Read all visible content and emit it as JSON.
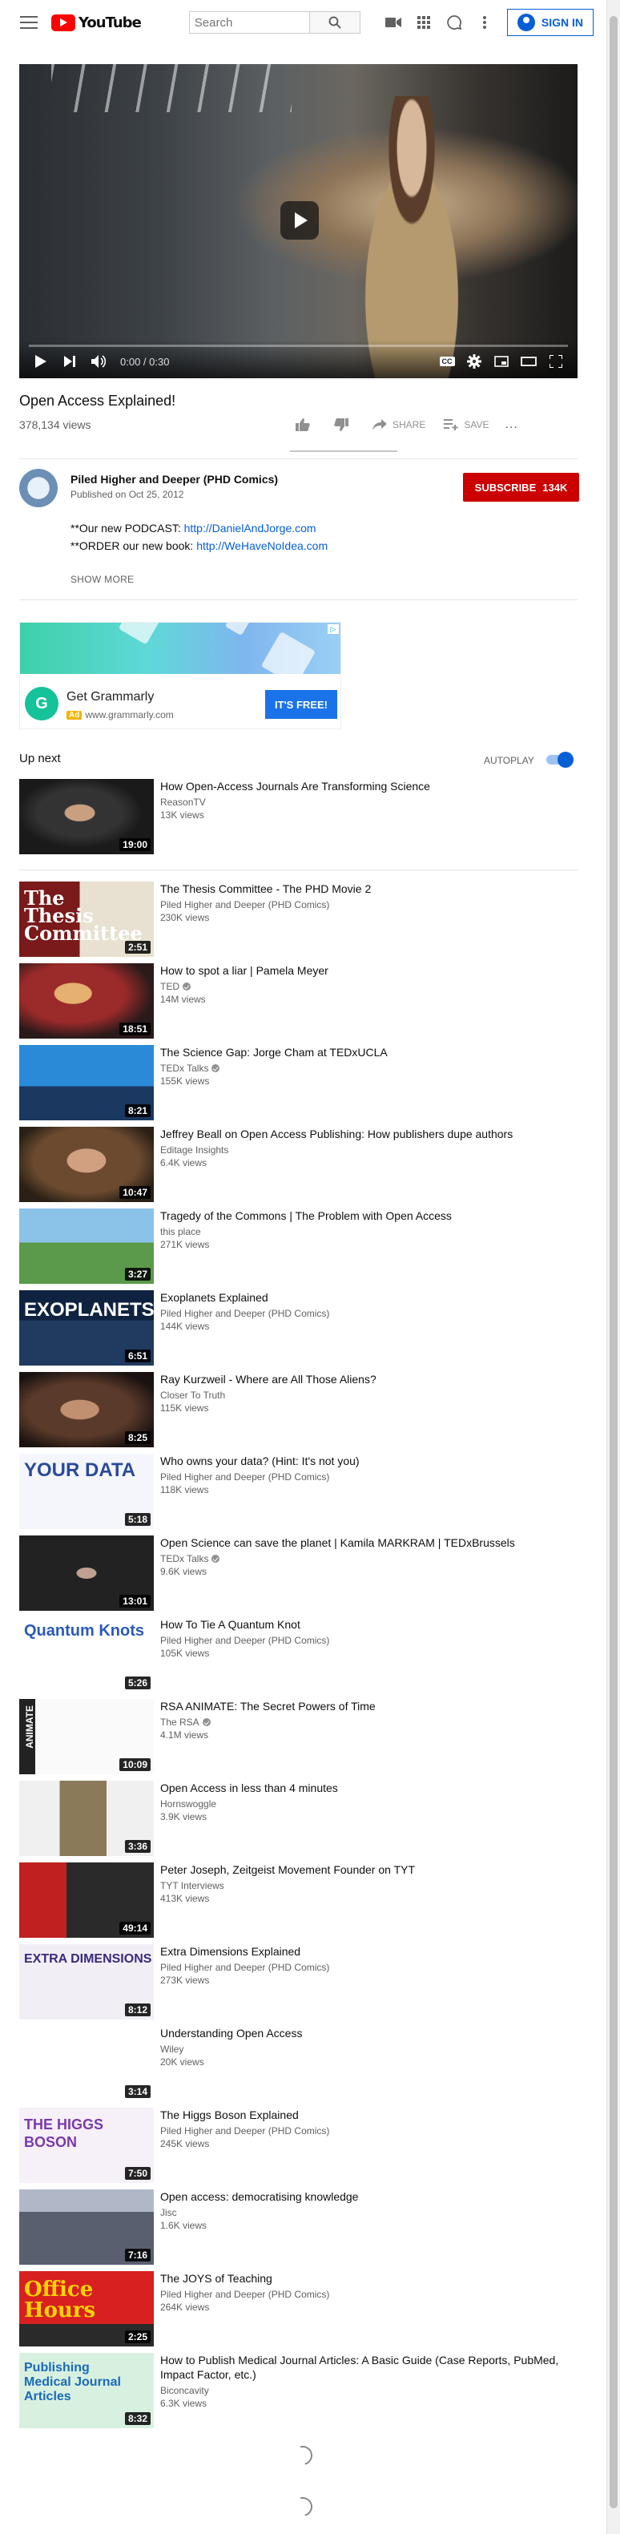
{
  "masthead": {
    "logo_text": "YouTube",
    "search_placeholder": "Search",
    "signin_label": "SIGN IN"
  },
  "player": {
    "time_current": "0:00",
    "time_total": "0:30",
    "time_separator": " / ",
    "captions_label": "CC"
  },
  "video": {
    "title": "Open Access Explained!",
    "views": "378,134 views",
    "like_label": "",
    "dislike_label": "",
    "share_label": "SHARE",
    "save_label": "SAVE",
    "more_label": "..."
  },
  "owner": {
    "name": "Piled Higher and Deeper (PHD Comics)",
    "published": "Published on Oct 25, 2012",
    "subscribe_label": "SUBSCRIBE",
    "subscriber_count": "134K"
  },
  "description": {
    "line1_prefix": "**Our new PODCAST: ",
    "line1_link": "http://DanielAndJorge.com",
    "line2_prefix": "**ORDER our new book: ",
    "line2_link": "http://WeHaveNoIdea.com",
    "show_more": "SHOW MORE"
  },
  "ad": {
    "name": "Get Grammarly",
    "badge": "Ad",
    "url": "www.grammarly.com",
    "cta": "IT'S FREE!",
    "logo_letter": "G"
  },
  "upnext": {
    "label": "Up next",
    "autoplay_label": "AUTOPLAY",
    "autoplay_on": true
  },
  "colors": {
    "brand_red": "#ff0000",
    "subscribe_red": "#cc0000",
    "link_blue": "#065fd4"
  },
  "videos": [
    {
      "title": "How Open-Access Journals Are Transforming Science",
      "channel": "ReasonTV",
      "verified": false,
      "views": "13K views",
      "duration": "19:00"
    },
    {
      "title": "The Thesis Committee - The PHD Movie 2",
      "channel": "Piled Higher and Deeper (PHD Comics)",
      "verified": false,
      "views": "230K views",
      "duration": "2:51"
    },
    {
      "title": "How to spot a liar | Pamela Meyer",
      "channel": "TED",
      "verified": true,
      "views": "14M views",
      "duration": "18:51"
    },
    {
      "title": "The Science Gap: Jorge Cham at TEDxUCLA",
      "channel": "TEDx Talks",
      "verified": true,
      "views": "155K views",
      "duration": "8:21"
    },
    {
      "title": "Jeffrey Beall on Open Access Publishing: How publishers dupe authors",
      "channel": "Editage Insights",
      "verified": false,
      "views": "6.4K views",
      "duration": "10:47"
    },
    {
      "title": "Tragedy of the Commons | The Problem with Open Access",
      "channel": "this place",
      "verified": false,
      "views": "271K views",
      "duration": "3:27"
    },
    {
      "title": "Exoplanets Explained",
      "channel": "Piled Higher and Deeper (PHD Comics)",
      "verified": false,
      "views": "144K views",
      "duration": "6:51"
    },
    {
      "title": "Ray Kurzweil - Where are All Those Aliens?",
      "channel": "Closer To Truth",
      "verified": false,
      "views": "115K views",
      "duration": "8:25"
    },
    {
      "title": "Who owns your data? (Hint: It's not you)",
      "channel": "Piled Higher and Deeper (PHD Comics)",
      "verified": false,
      "views": "118K views",
      "duration": "5:18"
    },
    {
      "title": "Open Science can save the planet | Kamila MARKRAM | TEDxBrussels",
      "channel": "TEDx Talks",
      "verified": true,
      "views": "9.6K views",
      "duration": "13:01"
    },
    {
      "title": "How To Tie A Quantum Knot",
      "channel": "Piled Higher and Deeper (PHD Comics)",
      "verified": false,
      "views": "105K views",
      "duration": "5:26"
    },
    {
      "title": "RSA ANIMATE: The Secret Powers of Time",
      "channel": "The RSA",
      "verified": true,
      "views": "4.1M views",
      "duration": "10:09"
    },
    {
      "title": "Open Access in less than 4 minutes",
      "channel": "Hornswoggle",
      "verified": false,
      "views": "3.9K views",
      "duration": "3:36"
    },
    {
      "title": "Peter Joseph, Zeitgeist Movement Founder on TYT",
      "channel": "TYT Interviews",
      "verified": false,
      "views": "413K views",
      "duration": "49:14"
    },
    {
      "title": "Extra Dimensions Explained",
      "channel": "Piled Higher and Deeper (PHD Comics)",
      "verified": false,
      "views": "273K views",
      "duration": "8:12"
    },
    {
      "title": "Understanding Open Access",
      "channel": "Wiley",
      "verified": false,
      "views": "20K views",
      "duration": "3:14"
    },
    {
      "title": "The Higgs Boson Explained",
      "channel": "Piled Higher and Deeper (PHD Comics)",
      "verified": false,
      "views": "245K views",
      "duration": "7:50"
    },
    {
      "title": "Open access: democratising knowledge",
      "channel": "Jisc",
      "verified": false,
      "views": "1.6K views",
      "duration": "7:16"
    },
    {
      "title": "The JOYS of Teaching",
      "channel": "Piled Higher and Deeper (PHD Comics)",
      "verified": false,
      "views": "264K views",
      "duration": "2:25"
    },
    {
      "title": "How to Publish Medical Journal Articles: A Basic Guide (Case Reports, PubMed, Impact Factor, etc.)",
      "channel": "Biconcavity",
      "verified": false,
      "views": "6.3K views",
      "duration": "8:32"
    }
  ],
  "thumb_captions": {
    "1": "The\nThesis\nCommittee",
    "6": "EXOPLANETS",
    "8": "YOUR DATA",
    "10": "Quantum Knots",
    "11": "ANIMATE",
    "14": "EXTRA DIMENSIONS",
    "16": "THE HIGGS BOSON",
    "18": "Office\nHours",
    "19": "Publishing\nMedical Journal Articles"
  }
}
